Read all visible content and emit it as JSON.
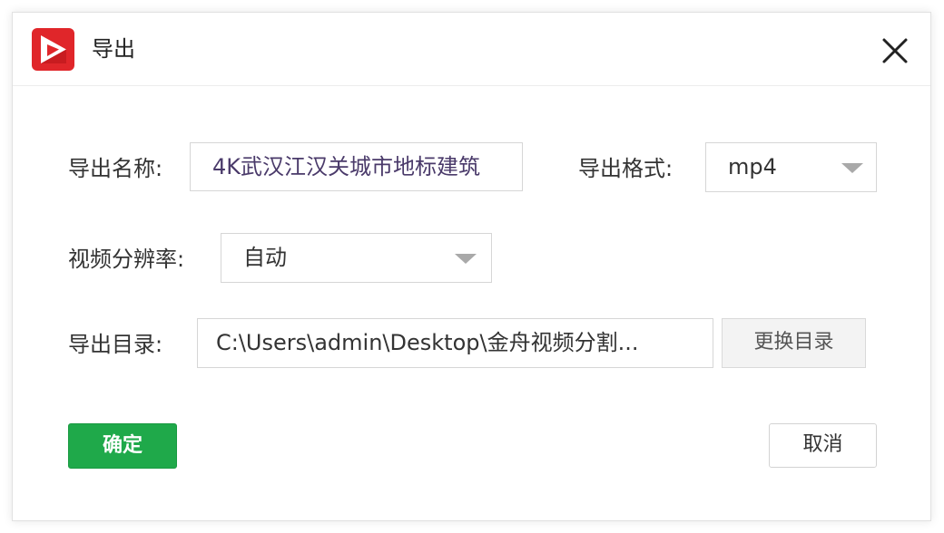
{
  "window": {
    "title": "导出",
    "icons": {
      "app": "app-logo-icon",
      "close": "close-icon"
    }
  },
  "form": {
    "name": {
      "label": "导出名称:",
      "value": "4K武汉江汉关城市地标建筑"
    },
    "format": {
      "label": "导出格式:",
      "value": "mp4"
    },
    "resolution": {
      "label": "视频分辨率:",
      "value": "自动"
    },
    "directory": {
      "label": "导出目录:",
      "value": "C:\\Users\\admin\\Desktop\\金舟视频分割...",
      "change_label": "更换目录"
    }
  },
  "buttons": {
    "ok_label": "确定",
    "cancel_label": "取消"
  },
  "colors": {
    "accent": "#1fa94a",
    "logo_red": "#e0262a",
    "border": "#d6d6d6"
  }
}
